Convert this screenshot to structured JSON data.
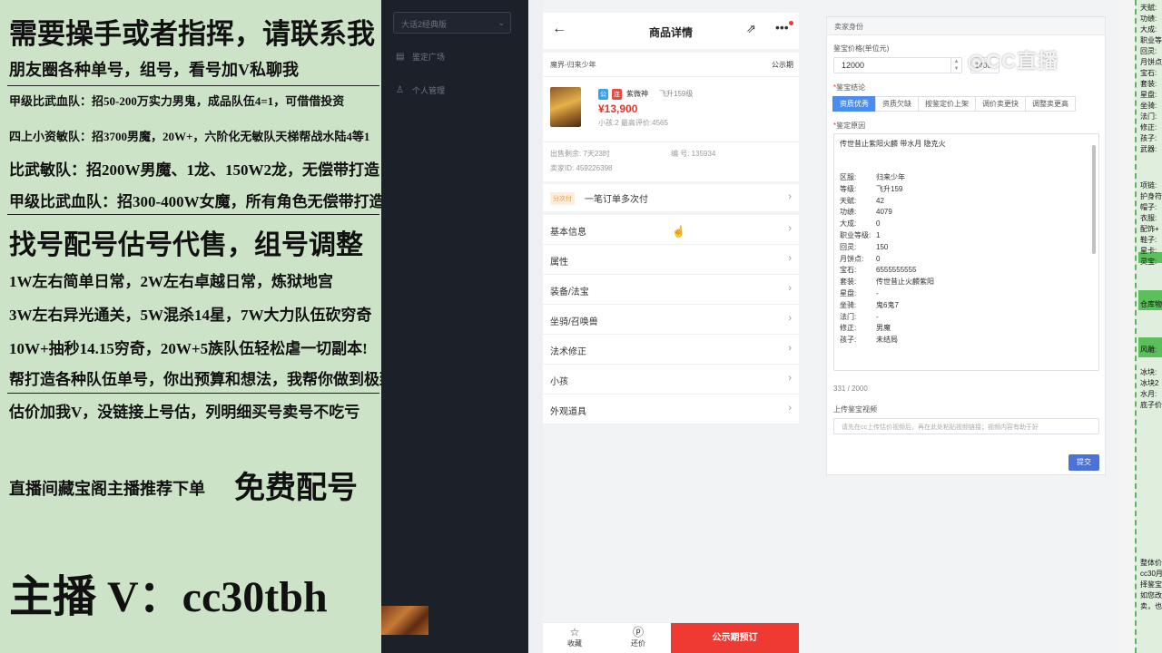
{
  "promo": {
    "lines": [
      "需要操手或者指挥，请联系我",
      "朋友圈各种单号，组号，看号加V私聊我",
      "甲级比武血队：招50-200万实力男鬼，成品队伍4=1，可借借投资",
      "四上小资敏队：招3700男魔，20W+，六阶化无敏队天梯帮战水陆4等1",
      "比武敏队：招200W男魔、1龙、150W2龙，无偿带打造",
      "甲级比武血队：招300-400W女魔，所有角色无偿带打造",
      "找号配号估号代售，组号调整",
      "1W左右简单日常，2W左右卓越日常，炼狱地宫",
      "3W左右异光通关，5W混杀14星，7W大力队伍砍穷奇",
      "10W+抽秒14.15穷奇，20W+5族队伍轻松虐一切副本!",
      "帮打造各种队伍单号，你出预算和想法，我帮你做到极致",
      "估价加我V，没链接上号估，列明细买号卖号不吃亏",
      "直播间藏宝阁主播推荐下单",
      "免费配号",
      "主播 V：cc30tbh"
    ]
  },
  "sidebar": {
    "select_value": "大话2经典版",
    "items": [
      "鉴定广场",
      "个人管理"
    ]
  },
  "phone": {
    "title": "商品详情",
    "category": "魔界-归来少年",
    "public_period": "公示期",
    "tag_gong": "公",
    "tag_lian": "连",
    "role_name": "紫微神",
    "level": "飞升159级",
    "price": "¥13,900",
    "sub": "小孩:2 最高评价:4565",
    "remaining": "出售剩余: 7天23时",
    "number": "编 号: 135934",
    "seller_id": "卖家ID: 459226398",
    "pay_tag": "分次付",
    "pay_text": "一笔订单多次付",
    "menu": [
      "基本信息",
      "属性",
      "装备/法宝",
      "坐骑/召唤兽",
      "法术修正",
      "小孩",
      "外观道具"
    ],
    "bottom": {
      "fav": "收藏",
      "bargain": "还价",
      "order": "公示期预订"
    }
  },
  "form": {
    "header": "卖家身份",
    "price_label": "鉴宝价格(单位元)",
    "price_value": "12000",
    "price2_value": "1400",
    "watermark": "CC直播",
    "conclusion_label": "鉴宝结论",
    "buttons": [
      "资质优秀",
      "资质欠缺",
      "按鉴定价上架",
      "调价卖更快",
      "调整卖更高"
    ],
    "active_button": 0,
    "reason_label": "鉴定原因",
    "text_first": "传世昔止紫阳火麟 带水月 隐克火",
    "rows": [
      [
        "区服:",
        "归来少年"
      ],
      [
        "等级:",
        "飞升159"
      ],
      [
        "天赋:",
        "42"
      ],
      [
        "功绩:",
        "4079"
      ],
      [
        "大成:",
        "0"
      ],
      [
        "职业等级:",
        "1"
      ],
      [
        "回灵:",
        "150"
      ],
      [
        "月饼点:",
        "0"
      ],
      [
        "宝石:",
        "6555555555"
      ],
      [
        "套装:",
        "传世昔止火麟紫阳"
      ],
      [
        "星盘:",
        "-"
      ],
      [
        "坐骑:",
        "鬼6鬼7"
      ],
      [
        "法门:",
        "-"
      ],
      [
        "修正:",
        "男魔"
      ],
      [
        "孩子:",
        "未结局"
      ]
    ],
    "count": "331 / 2000",
    "video_label": "上传鉴宝视频",
    "video_placeholder": "请先在cc上传估价视频后，再在此处粘贴视频链接；视频内容有助于好",
    "submit": "提交"
  },
  "right_panel": {
    "labels": [
      "天赋:",
      "功绩:",
      "大成:",
      "职业等",
      "回灵:",
      "月饼点",
      "宝石:",
      "套装:",
      "星盘:",
      "坐骑:",
      "法门:",
      "修正:",
      "孩子:",
      "武器:",
      "项链:",
      "护身符",
      "帽子:",
      "衣服:",
      "配饰+",
      "鞋子:",
      "星卡:",
      "灵宝:",
      "仓库物",
      "风雕:",
      "冰块:",
      "冰块2",
      "水月:",
      "底子价",
      "整体价",
      "cc30月",
      "择鉴宝",
      "如您改",
      "卖，也"
    ]
  },
  "colors": {
    "accent": "#4a8df0",
    "price_red": "#e4352c",
    "order_red": "#ee3a33",
    "promo_bg": "#cde3c8"
  }
}
